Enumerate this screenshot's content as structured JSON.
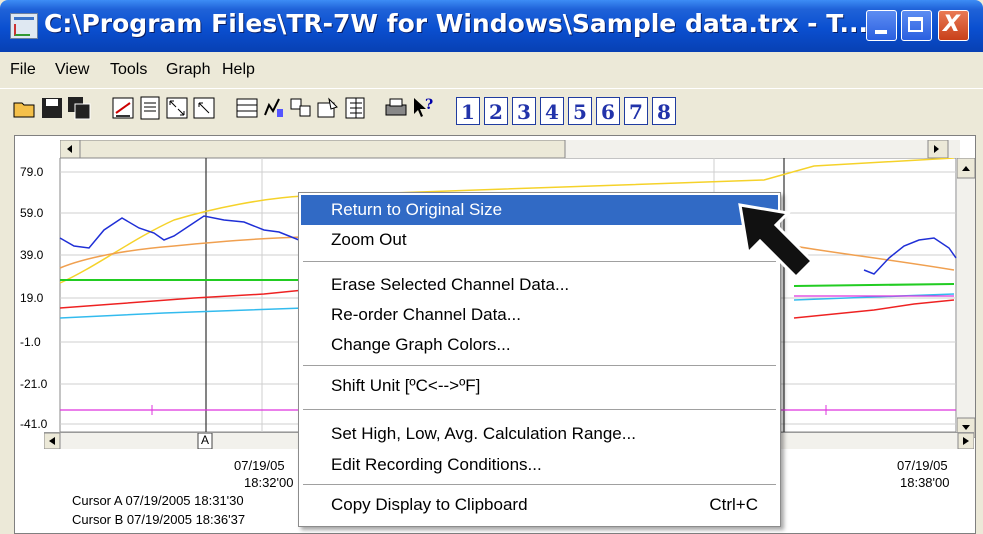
{
  "window": {
    "title": "C:\\Program Files\\TR-7W for Windows\\Sample data.trx - T...",
    "buttons": {
      "minimize": "minimize",
      "maximize": "maximize",
      "close": "X"
    }
  },
  "menu": [
    "File",
    "View",
    "Tools",
    "Graph",
    "Help"
  ],
  "toolbar": {
    "icons": [
      "open-folder-icon",
      "save-icon",
      "save-all-icon",
      "chart-settings-icon",
      "report-icon",
      "zoom-fit-icon",
      "zoom-out-icon",
      "table-icon",
      "edit-icon",
      "channel-icon",
      "properties-icon",
      "list-icon",
      "print-icon",
      "help-pointer-icon"
    ],
    "channels": [
      "1",
      "2",
      "3",
      "4",
      "5",
      "6",
      "7",
      "8"
    ]
  },
  "graph": {
    "y_ticks": [
      "79.0",
      "59.0",
      "39.0",
      "19.0",
      "-1.0",
      "-21.0",
      "-41.0"
    ],
    "cursor_a_marker": "A",
    "time_left": {
      "date": "07/19/05",
      "time": "18:32'00"
    },
    "time_right": {
      "date": "07/19/05",
      "time": "18:38'00"
    },
    "cursor_a": "Cursor A 07/19/2005 18:31'30",
    "cursor_b": "Cursor B 07/19/2005 18:36'37",
    "colors": {
      "blue": "#1f2fd6",
      "yellow": "#f5d22a",
      "orange": "#f0a050",
      "green": "#22cc22",
      "red": "#ee2222",
      "cyan": "#33bbee",
      "magenta": "#dd33dd"
    }
  },
  "context_menu": {
    "items": [
      {
        "label": "Return to Original Size",
        "highlighted": true
      },
      {
        "label": "Zoom Out"
      },
      {
        "label": "Erase Selected Channel Data..."
      },
      {
        "label": "Re-order Channel Data..."
      },
      {
        "label": "Change Graph Colors..."
      },
      {
        "label": "Shift Unit [ºC<-->ºF]"
      },
      {
        "label": "Set High, Low, Avg. Calculation Range..."
      },
      {
        "label": "Edit Recording Conditions..."
      },
      {
        "label": "Copy Display to Clipboard",
        "shortcut": "Ctrl+C"
      }
    ],
    "highlight_color": "#316ac5"
  }
}
